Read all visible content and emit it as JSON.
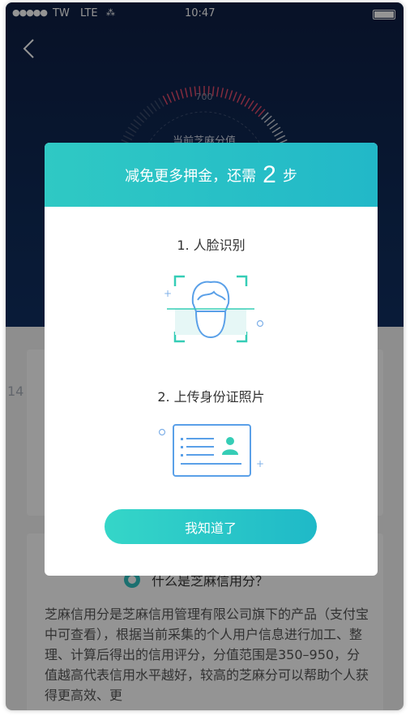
{
  "status_bar": {
    "signal": "●●●●●",
    "carrier": "TW",
    "network": "LTE",
    "loading": "⁂",
    "time": "10:47"
  },
  "gauge": {
    "tick_max_label": "700",
    "current_label": "当前芝麻分值"
  },
  "background": {
    "side_number": "14",
    "faq_question": "什么是芝麻信用分？",
    "faq_answer": "芝麻信用分是芝麻信用管理有限公司旗下的产品（支付宝中可查看），根据当前采集的个人用户信息进行加工、整理、计算后得出的信用评分，分值范围是350–950，分值越高代表信用水平越好，较高的芝麻分可以帮助个人获得更高效、更"
  },
  "modal": {
    "title_prefix": "减免更多押金，还需",
    "title_count": "2",
    "title_suffix": "步",
    "step1_label": "1. 人脸识别",
    "step2_label": "2. 上传身份证照片",
    "confirm_button": "我知道了"
  },
  "colors": {
    "accent": "#27c0c6",
    "hero": "#0f2a57",
    "icon_blue": "#5aa0e8",
    "icon_teal": "#35cdb6"
  }
}
